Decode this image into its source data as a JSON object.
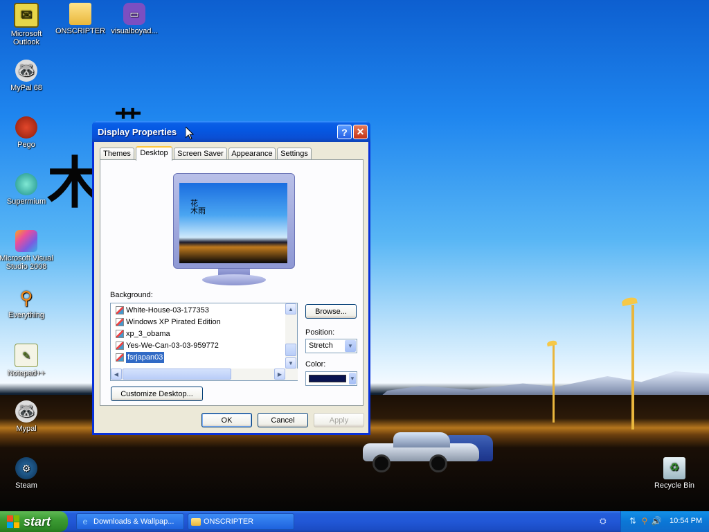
{
  "desktop": {
    "icons": [
      {
        "label": "Microsoft Outlook",
        "icon": "outlook-icon"
      },
      {
        "label": "ONSCRIPTER",
        "icon": "folder-icon"
      },
      {
        "label": "visualboyad...",
        "icon": "gameboy-icon"
      },
      {
        "label": "MyPal 68",
        "icon": "raccoon-icon"
      },
      {
        "label": "Pego",
        "icon": "pego-icon"
      },
      {
        "label": "Supermium",
        "icon": "supermium-icon"
      },
      {
        "label": "Microsoft Visual Studio 2008",
        "icon": "visual-studio-icon"
      },
      {
        "label": "Everything",
        "icon": "magnifier-icon"
      },
      {
        "label": "Notepad++",
        "icon": "notepad-plus-plus-icon"
      },
      {
        "label": "Mypal",
        "icon": "raccoon-icon"
      },
      {
        "label": "Steam",
        "icon": "steam-icon"
      },
      {
        "label": "Recycle Bin",
        "icon": "recycle-bin-icon"
      }
    ]
  },
  "window": {
    "title": "Display Properties",
    "tabs": [
      "Themes",
      "Desktop",
      "Screen Saver",
      "Appearance",
      "Settings"
    ],
    "active_tab": "Desktop",
    "background_label": "Background:",
    "backgrounds": [
      "White-House-03-177353",
      "Windows XP Pirated Edition",
      "xp_3_obama",
      "Yes-We-Can-03-03-959772",
      "fsrjapan03"
    ],
    "selected_background": "fsrjapan03",
    "browse_label": "Browse...",
    "position_label": "Position:",
    "position_value": "Stretch",
    "color_label": "Color:",
    "color_value": "#0a1450",
    "customize_label": "Customize Desktop...",
    "ok_label": "OK",
    "cancel_label": "Cancel",
    "apply_label": "Apply"
  },
  "taskbar": {
    "start_label": "start",
    "tasks": [
      {
        "label": "Downloads & Wallpap...",
        "icon": "internet-explorer-icon"
      },
      {
        "label": "ONSCRIPTER",
        "icon": "folder-icon"
      }
    ],
    "clock": "10:54 PM"
  }
}
